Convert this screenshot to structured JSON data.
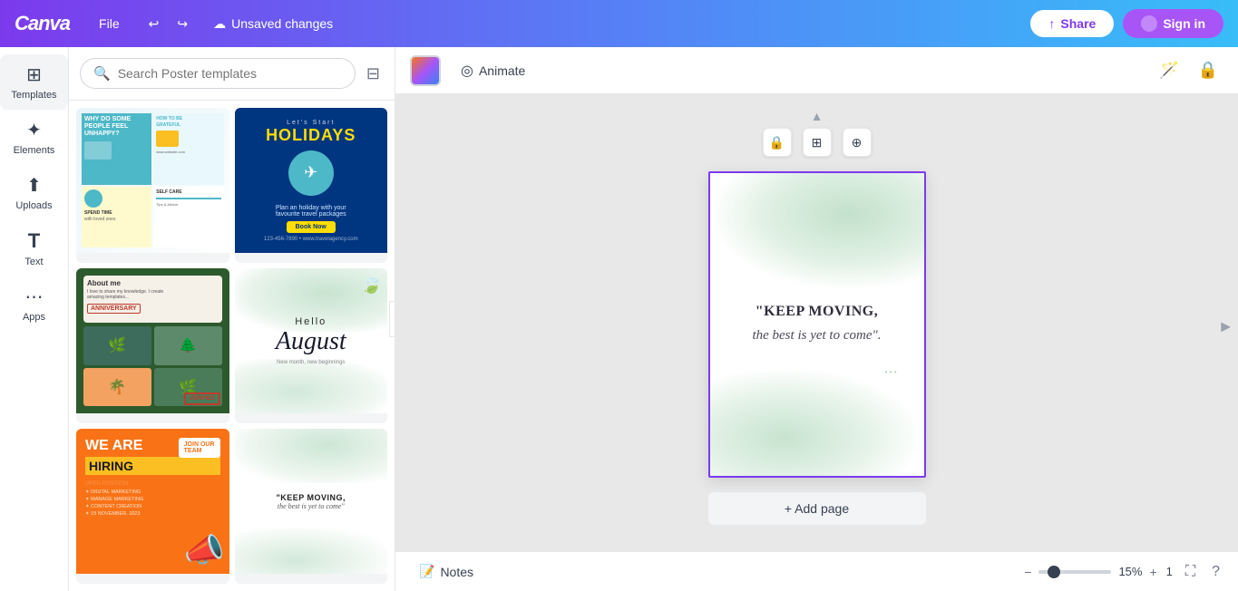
{
  "topbar": {
    "logo": "Canva",
    "file_label": "File",
    "undo_icon": "↩",
    "redo_icon": "↪",
    "unsaved_label": "Unsaved changes",
    "cloud_icon": "☁",
    "share_label": "Share",
    "signin_label": "Sign in"
  },
  "sidebar": {
    "items": [
      {
        "id": "templates",
        "label": "Templates",
        "icon": "⊞"
      },
      {
        "id": "elements",
        "label": "Elements",
        "icon": "✦"
      },
      {
        "id": "uploads",
        "label": "Uploads",
        "icon": "⬆"
      },
      {
        "id": "text",
        "label": "Text",
        "icon": "T"
      },
      {
        "id": "apps",
        "label": "Apps",
        "icon": "⋯"
      }
    ]
  },
  "templates_panel": {
    "search_placeholder": "Search Poster templates",
    "filter_icon": "⊟"
  },
  "canvas_toolbar": {
    "color_swatch_title": "Color picker",
    "animate_label": "Animate",
    "animate_icon": "◎",
    "lock_icon": "🔒",
    "fit_icon": "⊕",
    "add_icon": "⊞"
  },
  "canvas": {
    "page_controls": {
      "lock_icon": "🔒",
      "copy_icon": "⊞",
      "add_icon": "⊕"
    },
    "quote_main": "\"KEEP MOVING,",
    "quote_italic": "the best is yet to come\".",
    "add_page_label": "+ Add page"
  },
  "status_bar": {
    "notes_icon": "📝",
    "notes_label": "Notes",
    "zoom_minus": "−",
    "zoom_value": "15%",
    "zoom_plus": "+",
    "page_current": "1",
    "fullscreen_icon": "⛶",
    "help_icon": "?"
  }
}
